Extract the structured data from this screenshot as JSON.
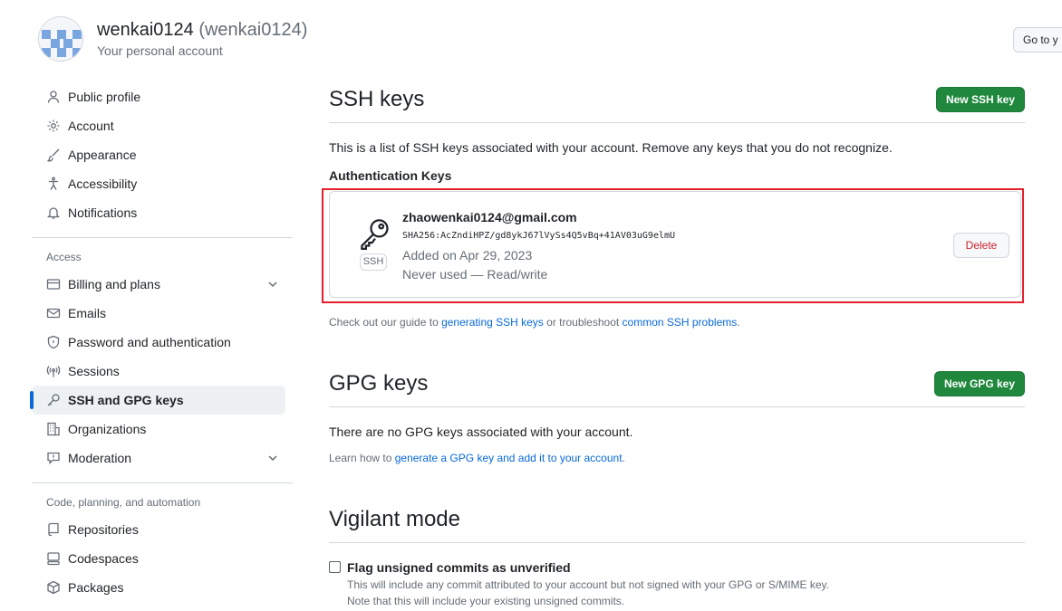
{
  "header": {
    "username": "wenkai0124",
    "handle": "(wenkai0124)",
    "subtitle": "Your personal account",
    "goto_label": "Go to y"
  },
  "sidebar": {
    "items_top": [
      {
        "label": "Public profile",
        "icon": "person-icon"
      },
      {
        "label": "Account",
        "icon": "gear-icon"
      },
      {
        "label": "Appearance",
        "icon": "paintbrush-icon"
      },
      {
        "label": "Accessibility",
        "icon": "accessibility-icon"
      },
      {
        "label": "Notifications",
        "icon": "bell-icon"
      }
    ],
    "access_label": "Access",
    "items_access": [
      {
        "label": "Billing and plans",
        "icon": "credit-card-icon"
      },
      {
        "label": "Emails",
        "icon": "mail-icon"
      },
      {
        "label": "Password and authentication",
        "icon": "shield-icon"
      },
      {
        "label": "Sessions",
        "icon": "broadcast-icon"
      },
      {
        "label": "SSH and GPG keys",
        "icon": "key-icon"
      },
      {
        "label": "Organizations",
        "icon": "organization-icon"
      },
      {
        "label": "Moderation",
        "icon": "report-icon"
      }
    ],
    "code_label": "Code, planning, and automation",
    "items_code": [
      {
        "label": "Repositories",
        "icon": "repo-icon"
      },
      {
        "label": "Codespaces",
        "icon": "codespaces-icon"
      },
      {
        "label": "Packages",
        "icon": "package-icon"
      }
    ]
  },
  "ssh": {
    "title": "SSH keys",
    "new_button": "New SSH key",
    "description": "This is a list of SSH keys associated with your account. Remove any keys that you do not recognize.",
    "auth_heading": "Authentication Keys",
    "key": {
      "email": "zhaowenkai0124@gmail.com",
      "fingerprint": "SHA256:AcZndiHPZ/gd8ykJ67lVySs4Q5vBq+41AV03uG9elmU",
      "added": "Added on Apr 29, 2023",
      "used": "Never used — Read/write",
      "badge": "SSH",
      "delete": "Delete"
    },
    "guide_prefix": "Check out our guide to ",
    "guide_link1": "generating SSH keys",
    "guide_mid": " or troubleshoot ",
    "guide_link2": "common SSH problems",
    "guide_suffix": "."
  },
  "gpg": {
    "title": "GPG keys",
    "new_button": "New GPG key",
    "empty": "There are no GPG keys associated with your account.",
    "learn_prefix": "Learn how to ",
    "learn_link": "generate a GPG key and add it to your account",
    "learn_suffix": "."
  },
  "vigilant": {
    "title": "Vigilant mode",
    "checkbox_label": "Flag unsigned commits as unverified",
    "checked": false,
    "note1": "This will include any commit attributed to your account but not signed with your GPG or S/MIME key.",
    "note2": "Note that this will include your existing unsigned commits."
  },
  "colors": {
    "accent": "#0969da",
    "green": "#1f883d",
    "danger": "#cf222e",
    "highlight": "#e5202e"
  }
}
